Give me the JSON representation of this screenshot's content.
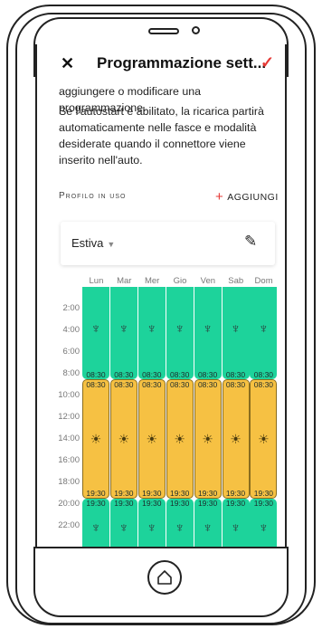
{
  "app": {
    "title": "Programmazione sett...",
    "close_icon": "✕",
    "confirm_icon": "✓"
  },
  "description": {
    "line1": "aggiungere o modificare una programmazione.",
    "line2": "Se l'autostart è abilitato, la ricarica partirà automaticamente nelle fasce e modalità desiderate quando il connettore viene inserito nell'auto."
  },
  "profile_section": {
    "label": "Profilo in uso",
    "add_label": "AGGIUNGI",
    "selected_profile": "Estiva"
  },
  "schedule": {
    "days": [
      "Lun",
      "Mar",
      "Mer",
      "Gio",
      "Ven",
      "Sab",
      "Dom"
    ],
    "hours": [
      "2:00",
      "4:00",
      "6:00",
      "8:00",
      "10:00",
      "12:00",
      "14:00",
      "16:00",
      "18:00",
      "20:00",
      "22:00"
    ],
    "slots": [
      {
        "mode": "tower",
        "start": "00:00",
        "end": "08:30",
        "end_label": "08:30"
      },
      {
        "mode": "solar",
        "start": "08:30",
        "end": "19:30",
        "start_label": "08:30",
        "end_label": "19:30"
      },
      {
        "mode": "tower",
        "start": "19:30",
        "end": "24:00",
        "start_label": "19:30"
      }
    ],
    "colors": {
      "tower": "#1dd39b",
      "solar": "#f6c143"
    }
  }
}
